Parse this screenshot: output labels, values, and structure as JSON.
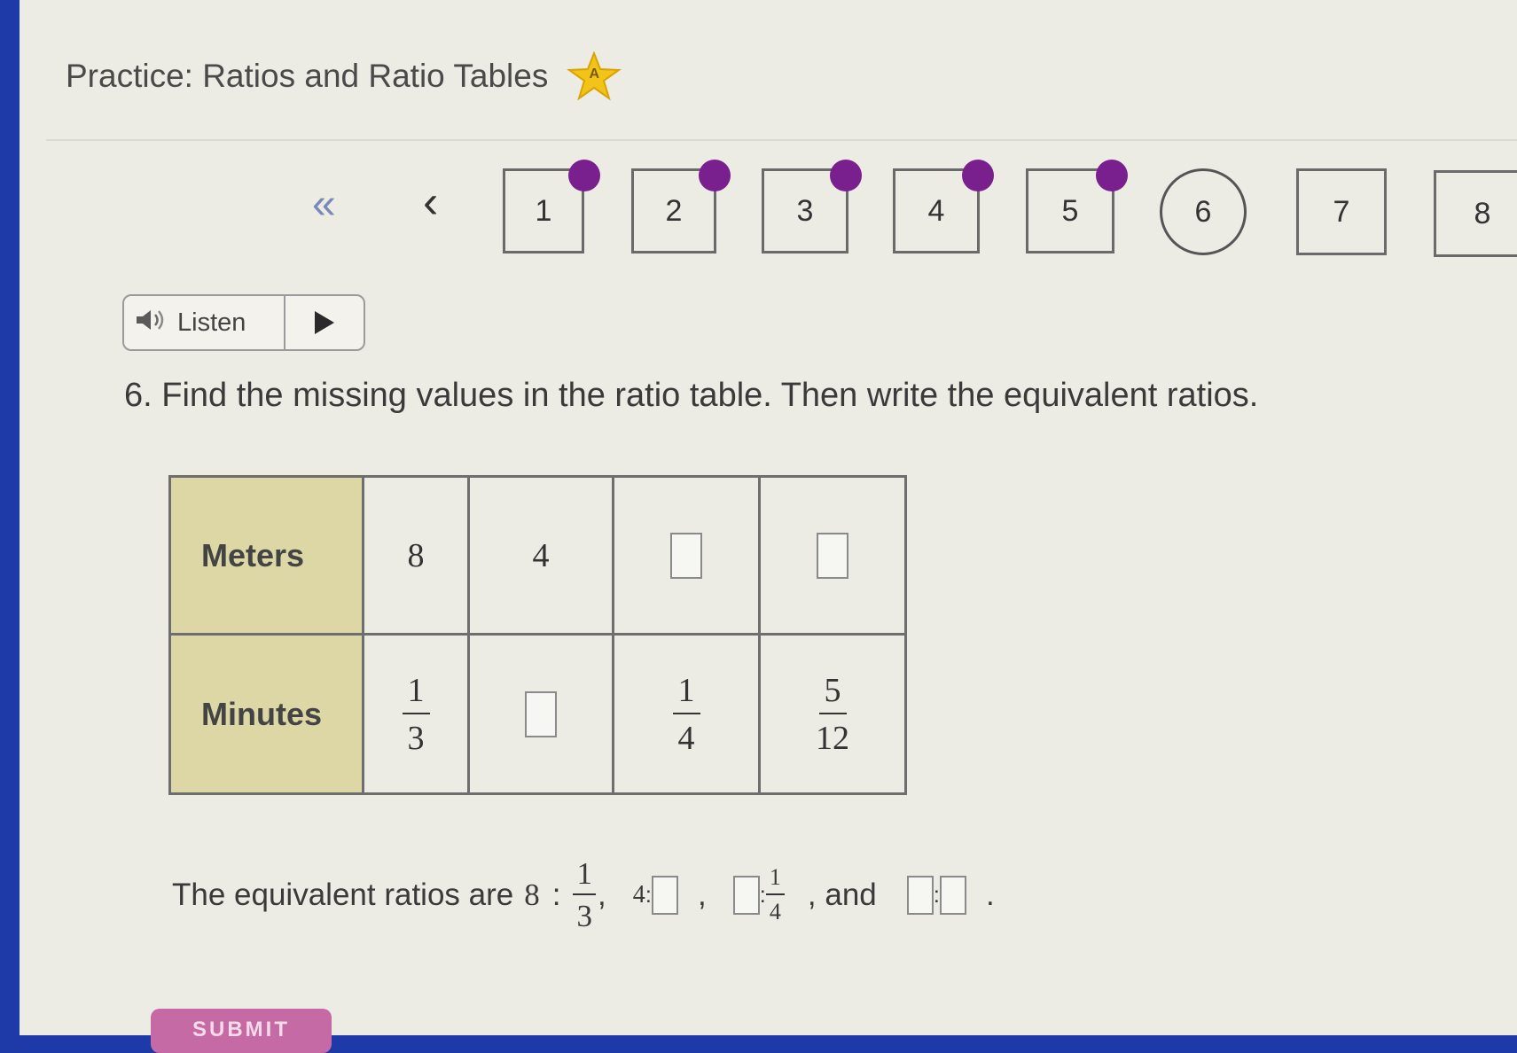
{
  "header": {
    "title": "Practice: Ratios and Ratio Tables",
    "badge_letter": "A"
  },
  "nav": {
    "first_glyph": "«",
    "prev_glyph": "‹",
    "questions": [
      {
        "label": "1",
        "state": "answered"
      },
      {
        "label": "2",
        "state": "answered"
      },
      {
        "label": "3",
        "state": "answered"
      },
      {
        "label": "4",
        "state": "answered"
      },
      {
        "label": "5",
        "state": "answered"
      },
      {
        "label": "6",
        "state": "current"
      },
      {
        "label": "7",
        "state": "unanswered"
      },
      {
        "label": "8",
        "state": "unanswered"
      }
    ]
  },
  "listen": {
    "label": "Listen"
  },
  "question": {
    "text": "6. Find the missing values in the ratio table. Then write the equivalent ratios."
  },
  "table": {
    "row_headers": [
      "Meters",
      "Minutes"
    ],
    "meters": {
      "c1": "8",
      "c2": "4"
    },
    "minutes": {
      "c1": {
        "num": "1",
        "den": "3"
      },
      "c3": {
        "num": "1",
        "den": "4"
      },
      "c4": {
        "num": "5",
        "den": "12"
      }
    }
  },
  "answer": {
    "prefix": "The equivalent ratios are",
    "r1_left": "8",
    "colon": ":",
    "r1_num": "1",
    "r1_den": "3",
    "r2_left": "4",
    "r3_num": "1",
    "r3_den": "4",
    "and": ", and",
    "period": "."
  },
  "submit": {
    "label": "SUBMIT"
  },
  "colors": {
    "answered_dot": "#7a1f8e",
    "header_cell": "#dcd7a4",
    "frame": "#1e3aa8"
  }
}
